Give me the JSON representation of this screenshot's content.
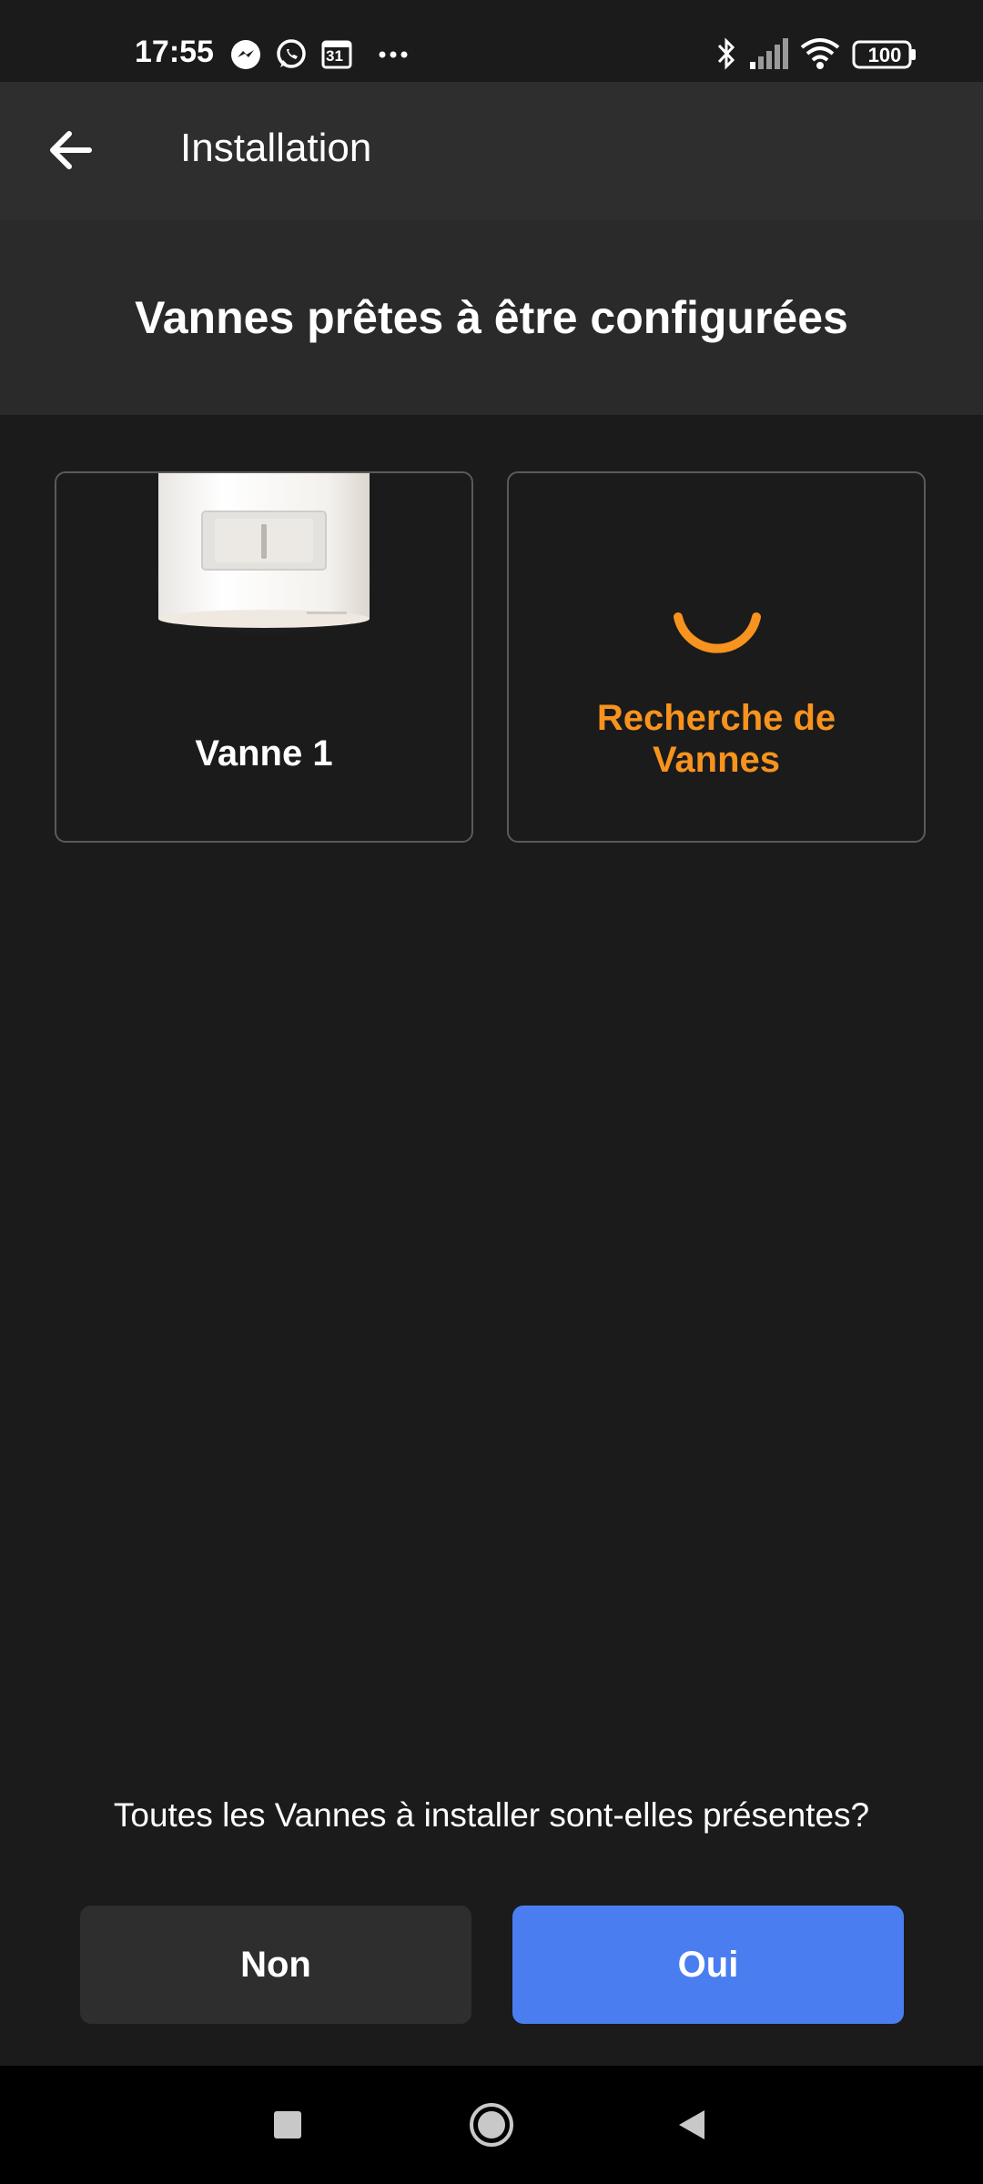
{
  "status_bar": {
    "time": "17:55",
    "notification_icons": [
      "messenger-icon",
      "whatsapp-icon",
      "calendar-icon",
      "more-dots-icon"
    ],
    "calendar_day": "31",
    "system_icons": [
      "bluetooth-icon",
      "signal-icon",
      "wifi-icon",
      "battery-icon"
    ],
    "battery": "100"
  },
  "app_bar": {
    "back_icon": "arrow-left-icon",
    "title": "Installation"
  },
  "heading": "Vannes prêtes à être configurées",
  "cards": {
    "valve": {
      "label": "Vanne 1",
      "image": "valve-device-image"
    },
    "search": {
      "label": "Recherche de Vannes",
      "icon": "loading-spinner-icon"
    }
  },
  "question": "Toutes les Vannes à installer sont-elles présentes?",
  "buttons": {
    "no_label": "Non",
    "yes_label": "Oui"
  },
  "nav_bar": {
    "icons": [
      "recents-square-icon",
      "home-circle-icon",
      "back-triangle-icon"
    ]
  },
  "colors": {
    "background": "#1b1b1b",
    "app_bar": "#2e2e2e",
    "heading_band": "#2a2a2a",
    "accent_orange": "#f7931e",
    "primary_blue": "#4a7ef0",
    "card_border": "#5a5a5a"
  }
}
